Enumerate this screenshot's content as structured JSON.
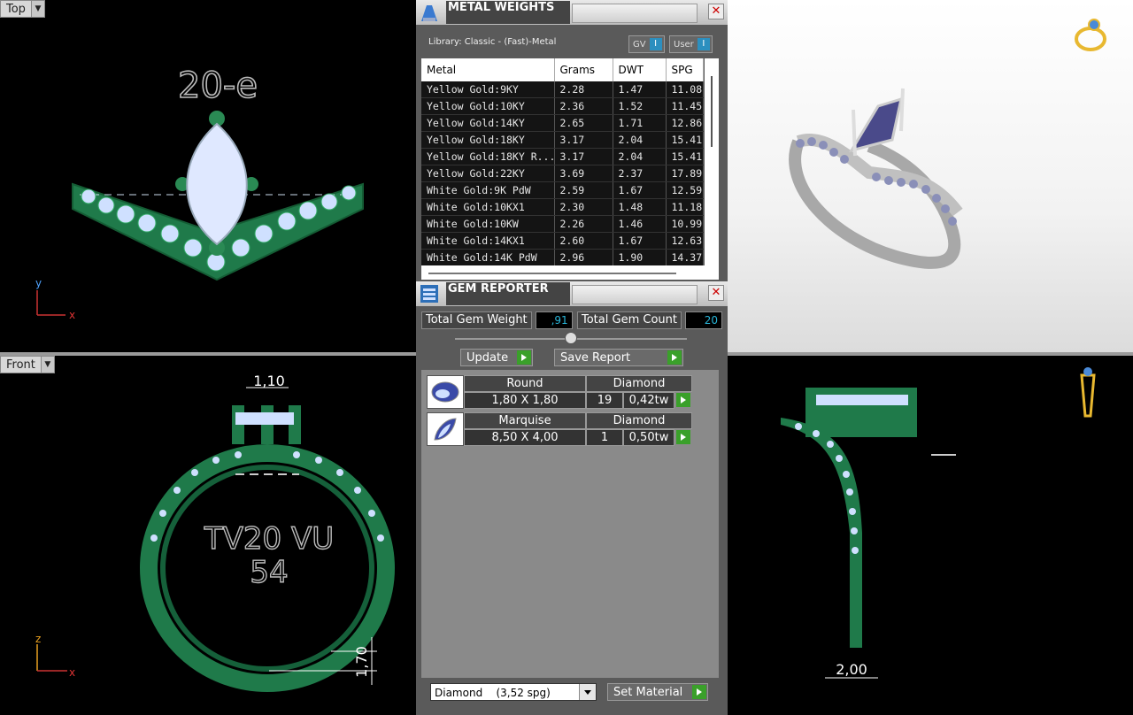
{
  "viewports": {
    "top": {
      "label": "Top",
      "annotation": "20-e",
      "axis_v": "y",
      "axis_h": "x"
    },
    "front": {
      "label": "Front",
      "dim_width": "1,10",
      "dim_thickness": "1,70",
      "inscription_line1": "TV20 VU",
      "inscription_line2": "54",
      "axis_v": "z",
      "axis_h": "x"
    },
    "right": {
      "dim_width": "2,00"
    }
  },
  "metal_weights": {
    "title": "METAL WEIGHTS",
    "library": "Library: Classic - (Fast)-Metal",
    "toggle_gv": "GV",
    "toggle_user": "User",
    "toggle_glyph": "I",
    "columns": [
      "Metal",
      "Grams",
      "DWT",
      "SPG"
    ],
    "rows": [
      [
        "Yellow Gold:9KY",
        "2.28",
        "1.47",
        "11.08"
      ],
      [
        "Yellow Gold:10KY",
        "2.36",
        "1.52",
        "11.45"
      ],
      [
        "Yellow Gold:14KY",
        "2.65",
        "1.71",
        "12.86"
      ],
      [
        "Yellow Gold:18KY",
        "3.17",
        "2.04",
        "15.41"
      ],
      [
        "Yellow Gold:18KY R...",
        "3.17",
        "2.04",
        "15.41"
      ],
      [
        "Yellow Gold:22KY",
        "3.69",
        "2.37",
        "17.89"
      ],
      [
        "White Gold:9K PdW",
        "2.59",
        "1.67",
        "12.59"
      ],
      [
        "White Gold:10KX1",
        "2.30",
        "1.48",
        "11.18"
      ],
      [
        "White Gold:10KW",
        "2.26",
        "1.46",
        "10.99"
      ],
      [
        "White Gold:14KX1",
        "2.60",
        "1.67",
        "12.63"
      ],
      [
        "White Gold:14K PdW",
        "2.96",
        "1.90",
        "14.37"
      ]
    ]
  },
  "gem_reporter": {
    "title": "GEM REPORTER",
    "total_weight_label": "Total Gem Weight",
    "total_weight_value": ",91",
    "total_count_label": "Total Gem Count",
    "total_count_value": "20",
    "update_label": "Update",
    "save_report_label": "Save Report",
    "gems": [
      {
        "shape": "Round",
        "material": "Diamond",
        "size": "1,80 X 1,80",
        "count": "19",
        "weight": "0,42tw"
      },
      {
        "shape": "Marquise",
        "material": "Diamond",
        "size": "8,50 X 4,00",
        "count": "1",
        "weight": "0,50tw"
      }
    ],
    "material_select": "Diamond    (3,52 spg)",
    "set_material_label": "Set Material"
  },
  "colors": {
    "ring_green": "#1f7a4a",
    "gem_fill": "#cfe0ff",
    "accent_green": "#3aa02a",
    "value_cyan": "#29b5d8"
  }
}
